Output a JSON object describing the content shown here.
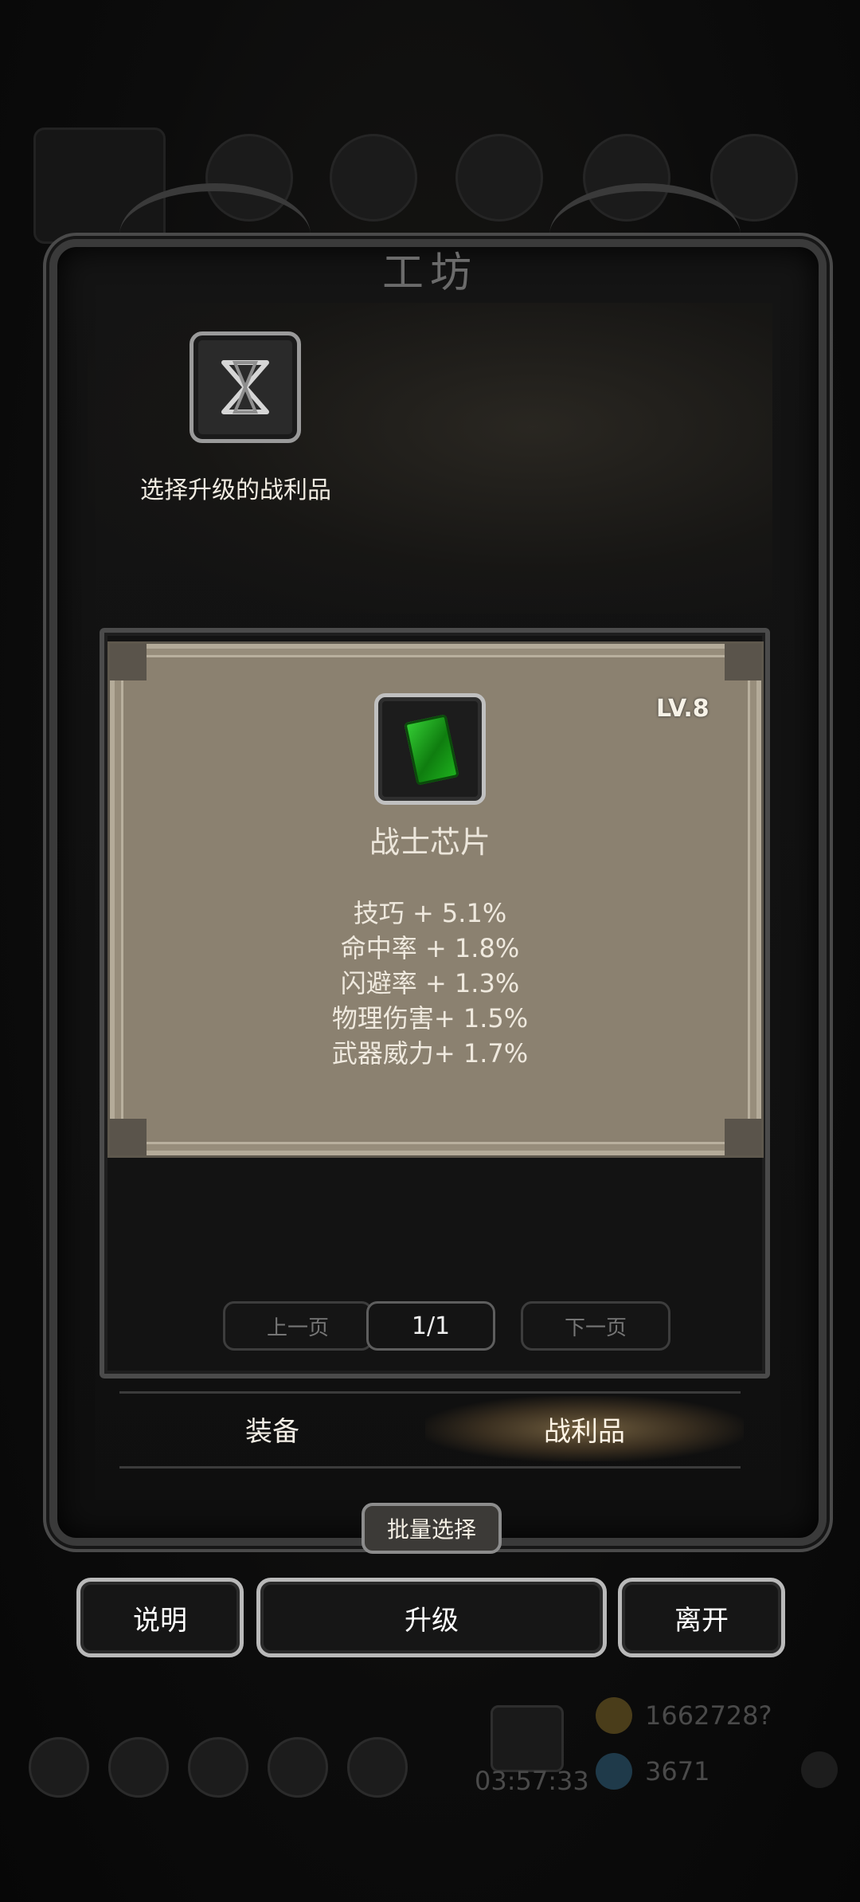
{
  "workshop": {
    "title": "工坊",
    "hint": "选择升级的战利品"
  },
  "item": {
    "level": "LV.8",
    "name": "战士芯片",
    "icon": "green-chip-icon",
    "stats": [
      "技巧 + 5.1%",
      "命中率 + 1.8%",
      "闪避率 + 1.3%",
      "物理伤害+ 1.5%",
      "武器威力+ 1.7%"
    ]
  },
  "pager": {
    "prev": "上一页",
    "current": "1/1",
    "next": "下一页"
  },
  "tabs": {
    "equipment": "装备",
    "loot": "战利品",
    "active": "战利品"
  },
  "batch_select": "批量选择",
  "actions": {
    "info": "说明",
    "upgrade": "升级",
    "leave": "离开"
  },
  "background": {
    "timer": "03:57:33",
    "gold": "1662728?",
    "gems": "3671"
  },
  "colors": {
    "card_bg": "#8b8170",
    "frame": "#3a3a3a",
    "chip_green": "#2ec42e"
  }
}
